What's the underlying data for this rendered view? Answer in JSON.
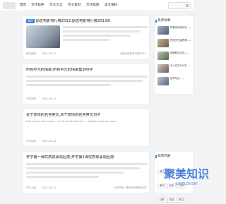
{
  "nav": {
    "items": [
      "首页",
      "写作指导",
      "作文大全",
      "作文素材",
      "写作指南",
      "美文摘抄"
    ]
  },
  "articles": [
    {
      "tag": "推荐",
      "title": "励志电影排行榜2013,励志电影排行榜2013年",
      "summary": "励志电影排行榜2013,励志电影排行榜2013年……",
      "category": "美文摘抄",
      "date": "2024-08-27",
      "views": "",
      "keyword": "#励志电影排行榜2013"
    },
    {
      "title": "所有中元的情歌,所有中元的情歌集900字",
      "summary": "所有中元的情歌,所有中元的情歌集900字……",
      "category": "写作指导",
      "date": "2024-08-15",
      "views": "",
      "keyword": ""
    },
    {
      "title": "关于爱情的名言英文,关于爱情的名言英文句子",
      "summary": "Love is more than a word ... If I do not like the time ... disappear from my world...",
      "category": "写作指导",
      "date": "2024-08-18",
      "views": "",
      "keyword": ""
    },
    {
      "title": "开学第一课优质故事观后感,开学第1课优质故事观后感",
      "summary": "",
      "category": "作文大全",
      "date": "2024-08-20",
      "views": "",
      "keyword": "#开学第一课优质故事观后感"
    }
  ],
  "sidebar": {
    "hot_title": "热评文章",
    "hot_items": [
      "带着你的信仰去……",
      "西班牙巴塞罗那……",
      "用眼睛记住的……",
      "写人作文600字……",
      "如何写出……"
    ],
    "tags_title": "标签列表",
    "tags": [
      "美文",
      "作文",
      "青春",
      "素材",
      "励志",
      "写作",
      "诗歌",
      "故事",
      "散文"
    ]
  },
  "colors": {
    "accent": "#3a7bd5",
    "watermark": "#2e6fd6"
  },
  "watermark": {
    "text": "聚美知识",
    "sub": "JUMEIZHISHI"
  }
}
